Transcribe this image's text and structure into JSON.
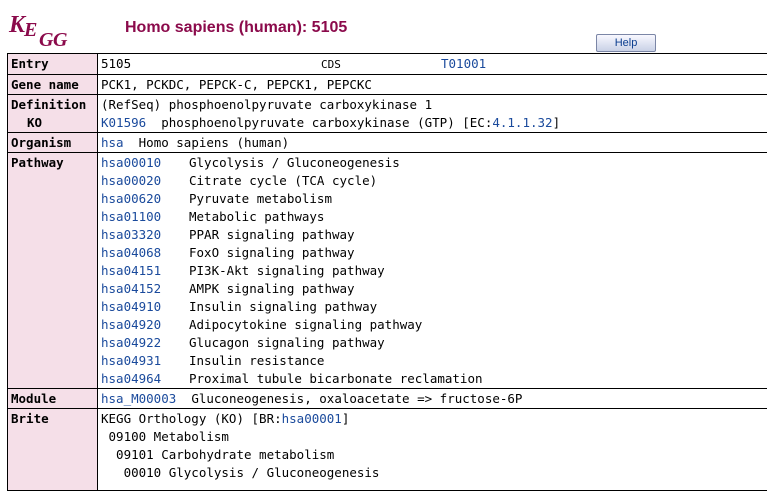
{
  "header": {
    "logo_text": "KEGG",
    "title": "Homo sapiens (human): 5105",
    "help_label": "Help"
  },
  "entry": {
    "label": "Entry",
    "id": "5105",
    "type": "CDS",
    "org_id": "T01001"
  },
  "gene_name": {
    "label": "Gene name",
    "value": "PCK1, PCKDC, PEPCK-C, PEPCK1, PEPCKC"
  },
  "definition": {
    "label": "Definition",
    "value": "(RefSeq) phosphoenolpyruvate carboxykinase 1"
  },
  "ko": {
    "label": "KO",
    "id": "K01596",
    "desc": "phosphoenolpyruvate carboxykinase (GTP) [EC:",
    "ec": "4.1.1.32",
    "desc_end": "]"
  },
  "organism": {
    "label": "Organism",
    "code": "hsa",
    "name": "Homo sapiens (human)"
  },
  "pathway": {
    "label": "Pathway",
    "items": [
      {
        "id": "hsa00010",
        "name": "Glycolysis / Gluconeogenesis"
      },
      {
        "id": "hsa00020",
        "name": "Citrate cycle (TCA cycle)"
      },
      {
        "id": "hsa00620",
        "name": "Pyruvate metabolism"
      },
      {
        "id": "hsa01100",
        "name": "Metabolic pathways"
      },
      {
        "id": "hsa03320",
        "name": "PPAR signaling pathway"
      },
      {
        "id": "hsa04068",
        "name": "FoxO signaling pathway"
      },
      {
        "id": "hsa04151",
        "name": "PI3K-Akt signaling pathway"
      },
      {
        "id": "hsa04152",
        "name": "AMPK signaling pathway"
      },
      {
        "id": "hsa04910",
        "name": "Insulin signaling pathway"
      },
      {
        "id": "hsa04920",
        "name": "Adipocytokine signaling pathway"
      },
      {
        "id": "hsa04922",
        "name": "Glucagon signaling pathway"
      },
      {
        "id": "hsa04931",
        "name": "Insulin resistance"
      },
      {
        "id": "hsa04964",
        "name": "Proximal tubule bicarbonate reclamation"
      }
    ]
  },
  "module": {
    "label": "Module",
    "id": "hsa_M00003",
    "name": "Gluconeogenesis, oxaloacetate => fructose-6P"
  },
  "brite": {
    "label": "Brite",
    "line1_prefix": "KEGG Orthology (KO) [BR:",
    "line1_link": "hsa00001",
    "line1_suffix": "]",
    "line2": " 09100 Metabolism",
    "line3": "  09101 Carbohydrate metabolism",
    "line4": "   00010 Glycolysis / Gluconeogenesis"
  }
}
